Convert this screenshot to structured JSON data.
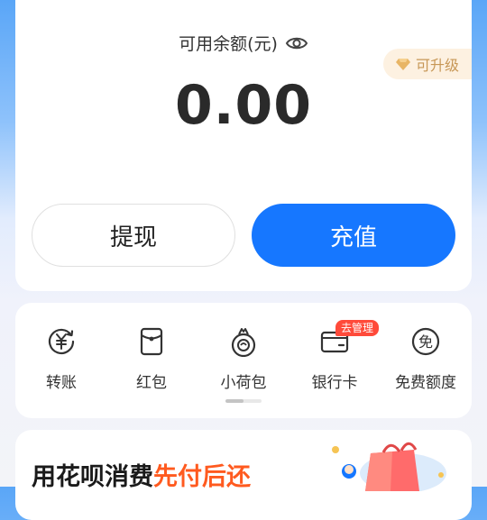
{
  "balance": {
    "label": "可用余额(元)",
    "amount": "0.00",
    "upgrade_badge": "可升级"
  },
  "actions": {
    "withdraw_label": "提现",
    "recharge_label": "充值"
  },
  "services": {
    "items": [
      {
        "label": "转账",
        "icon": "yuan-transfer-icon"
      },
      {
        "label": "红包",
        "icon": "red-envelope-icon"
      },
      {
        "label": "小荷包",
        "icon": "purse-icon"
      },
      {
        "label": "银行卡",
        "icon": "bank-card-icon",
        "badge": "去管理"
      },
      {
        "label": "免费额度",
        "icon": "free-quota-icon"
      }
    ],
    "pager_progress": 0.5
  },
  "promo": {
    "text_plain": "用花呗消费",
    "text_highlight": "先付后还"
  },
  "colors": {
    "accent": "#1677ff",
    "badge_red": "#ff4a3a",
    "promo_highlight": "#ff5a1f",
    "upgrade_gold": "#c79756"
  }
}
